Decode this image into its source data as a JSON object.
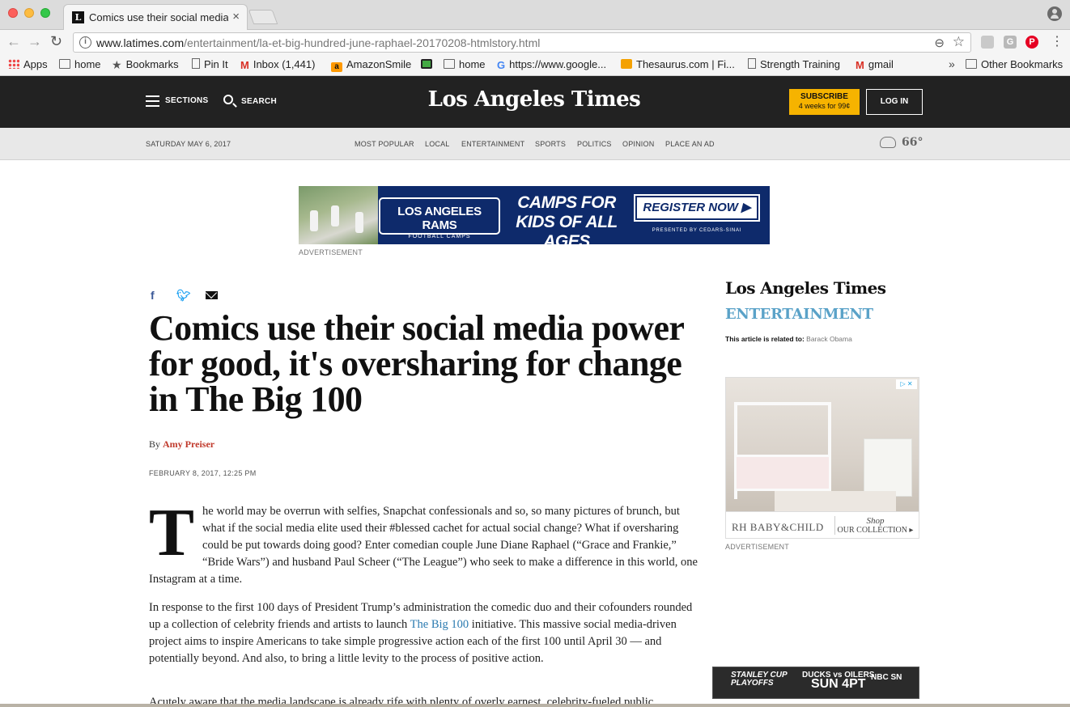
{
  "browser": {
    "tab_title": "Comics use their social media power for good, it's oversharing for change in The Big 100",
    "tab_favicon": "L",
    "url_host": "www.latimes.com",
    "url_path": "/entertainment/la-et-big-hundred-june-raphael-20170208-htmlstory.html",
    "info_glyph": "i",
    "ext_g": "G",
    "ext_pin": "P",
    "bookmarks": [
      {
        "label": "Apps",
        "icon": "apps-icon"
      },
      {
        "label": "home",
        "icon": "folder-icon"
      },
      {
        "label": "Bookmarks",
        "icon": "star-icon"
      },
      {
        "label": "Pin It",
        "icon": "page-icon"
      },
      {
        "label": "Inbox (1,441)",
        "icon": "gmail-icon"
      },
      {
        "label": "AmazonSmile",
        "icon": "amazon-icon"
      },
      {
        "label": "home",
        "icon": "folder-icon"
      },
      {
        "label": "https://www.google...",
        "icon": "google-icon"
      },
      {
        "label": "Thesaurus.com | Fi...",
        "icon": "thesaurus-icon"
      },
      {
        "label": "Strength Training",
        "icon": "page-icon"
      },
      {
        "label": "gmail",
        "icon": "gmail-icon"
      }
    ],
    "bookmarks_more": "»",
    "other_bookmarks": "Other Bookmarks"
  },
  "site": {
    "sections_label": "SECTIONS",
    "search_label": "SEARCH",
    "logo": "Los Angeles Times",
    "subscribe_line1": "SUBSCRIBE",
    "subscribe_line2": "4 weeks for 99¢",
    "login_label": "LOG IN",
    "date": "SATURDAY MAY 6, 2017",
    "nav": [
      "MOST POPULAR",
      "LOCAL",
      "ENTERTAINMENT",
      "SPORTS",
      "POLITICS",
      "OPINION",
      "PLACE AN AD"
    ],
    "temperature": "66°"
  },
  "top_ad": {
    "rams_line1": "LOS ANGELES RAMS",
    "rams_line2": "FOOTBALL CAMPS",
    "headline": "CAMPS FOR KIDS OF ALL AGES",
    "cta": "REGISTER NOW ▶",
    "presented": "PRESENTED BY  CEDARS-SINAI",
    "label": "ADVERTISEMENT"
  },
  "article": {
    "headline": "Comics use their social media power for good, it's oversharing for change in The Big 100",
    "byline_prefix": "By",
    "author": "Amy Preiser",
    "published": "FEBRUARY 8, 2017, 12:25 PM",
    "dropcap": "T",
    "p1": "he world may be overrun with selfies, Snapchat confessionals and so, so many pictures of brunch, but what if the social media elite used their #blessed cachet for actual social change? What if oversharing could be put towards doing good? Enter comedian couple June Diane Raphael (“Grace and Frankie,” “Bride Wars”) and husband Paul Scheer (“The League”) who seek to make a difference in this world, one Instagram at a time.",
    "p2_before": "In response to the first 100 days of President Trump’s administration the comedic duo and their cofounders rounded up a collection of celebrity friends and artists to launch ",
    "p2_link": "The Big 100",
    "p2_after": " initiative. This massive social media-driven project aims to inspire Americans to take simple progressive action each of the first 100 until April 30 — and potentially beyond. And also, to bring a little levity to the process of positive action.",
    "p3": "Acutely aware that the media landscape is already rife with plenty of overly earnest, celebrity-fueled public"
  },
  "sidebar": {
    "logo": "Los Angeles Times",
    "section": "ENTERTAINMENT",
    "related_prefix": "This article is related to:",
    "related_topic": "Barack Obama",
    "ad_brand": "RH BABY&CHILD",
    "ad_shop_line1": "Shop",
    "ad_shop_line2": "OUR COLLECTION ▸",
    "ad_choices": "▷ ✕",
    "ad_label": "ADVERTISEMENT",
    "nhl_line1": "STANLEY CUP",
    "nhl_line2": "PLAYOFFS",
    "nhl_match": "DUCKS vs OILERS",
    "nhl_time": "SUN 4PT",
    "nhl_network": "NBC SN"
  }
}
